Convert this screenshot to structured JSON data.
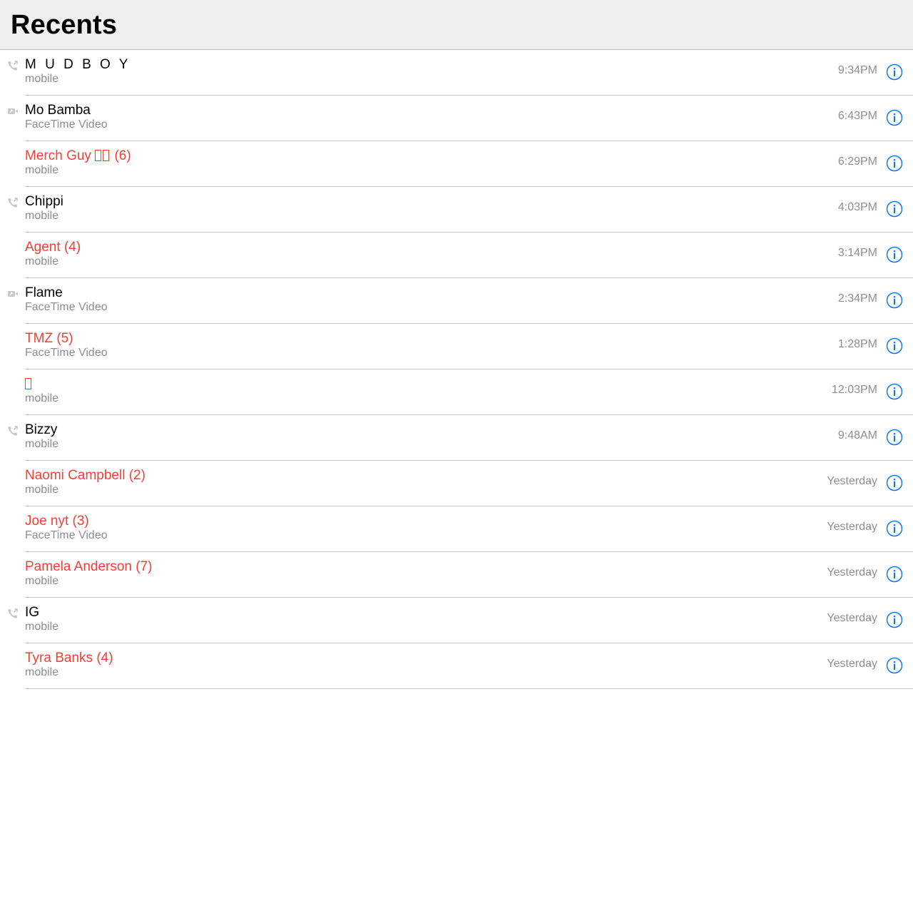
{
  "header": {
    "title": "Recents"
  },
  "colors": {
    "missed": "#ff3b30",
    "accent": "#007aff",
    "secondary": "#8e8e93"
  },
  "calls": [
    {
      "name": "M U D B O Y",
      "type": "mobile",
      "time": "9:34PM",
      "missed": false,
      "icon": "outgoing-call-icon"
    },
    {
      "name": "Mo Bamba",
      "type": "FaceTime Video",
      "time": "6:43PM",
      "missed": false,
      "icon": "video-call-icon"
    },
    {
      "name_prefix": "Merch Guy ",
      "name_suffix": " (6)",
      "boxes": 2,
      "type": "mobile",
      "time": "6:29PM",
      "missed": true,
      "icon": ""
    },
    {
      "name": "Chippi",
      "type": "mobile",
      "time": "4:03PM",
      "missed": false,
      "icon": "outgoing-call-icon"
    },
    {
      "name": "Agent (4)",
      "type": "mobile",
      "time": "3:14PM",
      "missed": true,
      "icon": ""
    },
    {
      "name": "Flame",
      "type": "FaceTime Video",
      "time": "2:34PM",
      "missed": false,
      "icon": "video-call-icon"
    },
    {
      "name": "TMZ (5)",
      "type": "FaceTime Video",
      "time": "1:28PM",
      "missed": true,
      "icon": ""
    },
    {
      "name_prefix": "",
      "name_suffix": "",
      "boxes": 1,
      "type": "mobile",
      "time": "12:03PM",
      "missed": true,
      "icon": ""
    },
    {
      "name": "Bizzy",
      "type": "mobile",
      "time": "9:48AM",
      "missed": false,
      "icon": "outgoing-call-icon"
    },
    {
      "name": "Naomi Campbell (2)",
      "type": "mobile",
      "time": "Yesterday",
      "missed": true,
      "icon": ""
    },
    {
      "name": "Joe nyt (3)",
      "type": "FaceTime Video",
      "time": "Yesterday",
      "missed": true,
      "icon": ""
    },
    {
      "name": "Pamela Anderson (7)",
      "type": "mobile",
      "time": "Yesterday",
      "missed": true,
      "icon": ""
    },
    {
      "name": "IG",
      "type": "mobile",
      "time": "Yesterday",
      "missed": false,
      "icon": "outgoing-call-icon"
    },
    {
      "name": "Tyra Banks (4)",
      "type": "mobile",
      "time": "Yesterday",
      "missed": true,
      "icon": ""
    }
  ]
}
